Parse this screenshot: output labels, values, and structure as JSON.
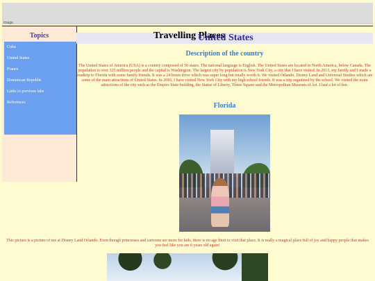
{
  "browser": {
    "broken_image_alt": "Image"
  },
  "sidebar": {
    "title": "Topics",
    "items": [
      {
        "label": "Cuba"
      },
      {
        "label": "United States"
      },
      {
        "label": "France"
      },
      {
        "label": "Dominican Republic"
      },
      {
        "label": "Links to previous labs"
      },
      {
        "label": "References"
      }
    ]
  },
  "header": {
    "site_title": "Travelling Places",
    "page_title": "United States"
  },
  "main": {
    "description_heading": "Description of the country",
    "description": "The United States of America (USA) is a country composed of 50 states. The national language is English. The United States are located in North America, below Canada. The population is over 325 million people and the capital is Washington. The largest city by population is New York City, a city that I have visited. In 2013, my family and I made a roadtrip to Florida with some family friends. It was a 24 hours drive which was super long but totally worth it. We visited Orlando, Disney Land and Universal Studios which are some of the main attractions of United States. In 2016, I have visited New York City with my high school friends. It was a trip organized by the school. We visited the main attractions of the city such as the Empire State building, the Statue of Liberty, Times Square and the Metropolitan Museum of Art. I had a lot of fun.",
    "florida_heading": "Florida",
    "photo_caption": "This picture is a picture of me at Disney Land Orlando. Even though princesses and cartoons are more for kids, there is no age limit to visit that place. It is really a magical place full of joy and happy people that makes you feel like you are 6 years old again!"
  },
  "colors": {
    "background": "#fffbd0",
    "sidebar_bg": "#fde9d6",
    "nav_bg": "#6aa0ef",
    "heading_blue": "#2b7fe0",
    "text_red": "#c0392b",
    "title_purple": "#4b3aa5"
  }
}
